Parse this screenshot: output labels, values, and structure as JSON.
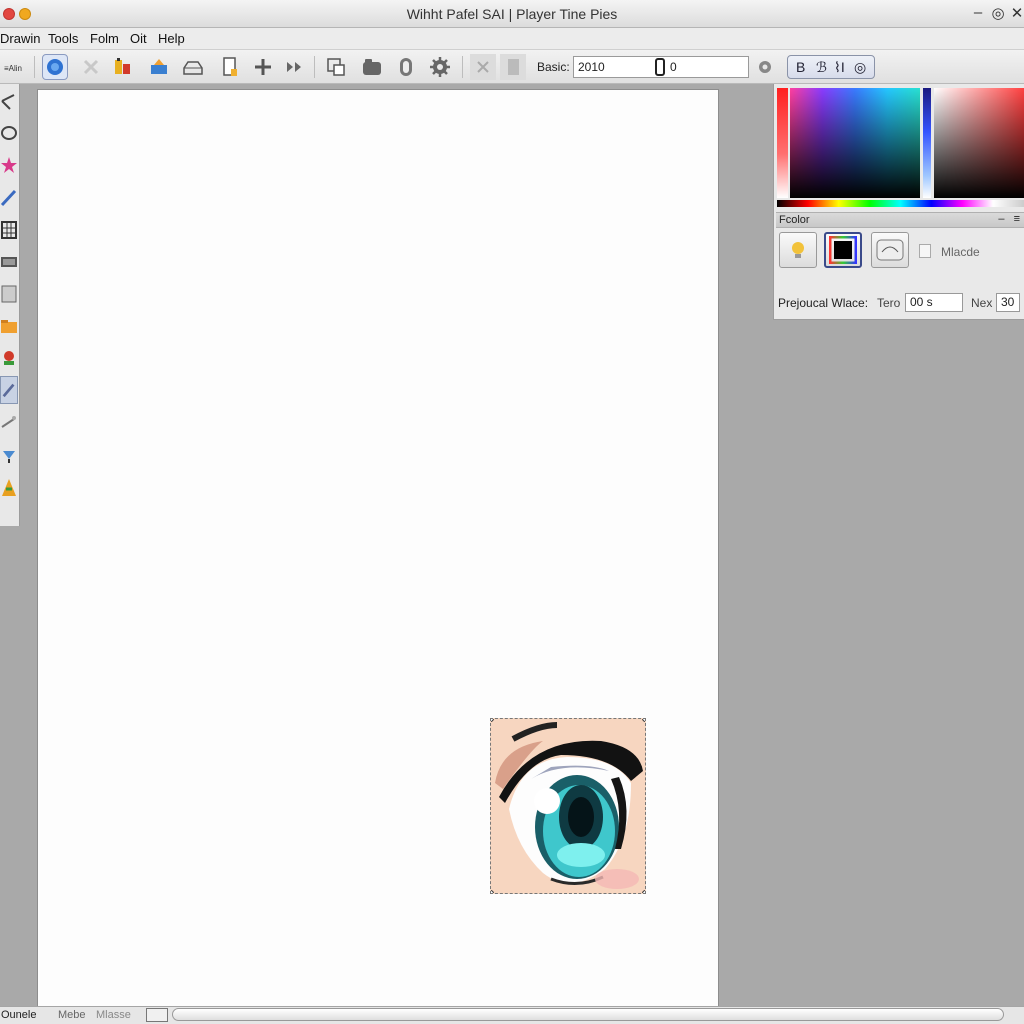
{
  "window": {
    "title": "Wihht Pafel SAI | Player Tine Pies",
    "controls": [
      "–",
      "◎",
      "✕"
    ]
  },
  "menubar": {
    "items": [
      "Drawin",
      "Tools",
      "Folm",
      "Oit",
      "Help"
    ]
  },
  "toolbar": {
    "icons": [
      "brush-settings-icon",
      "close-icon",
      "paint-tube-icon",
      "fill-bucket-icon",
      "tray-icon",
      "document-icon",
      "plus-icon",
      "shuffle-icon",
      "crop-icon",
      "folder-icon",
      "capsule-icon",
      "gear-icon",
      "cancel-icon",
      "page-icon"
    ],
    "basic_label": "Basic:",
    "basic_value": "2010",
    "basic_value2": "0",
    "format_buttons": [
      "B",
      "ℬ",
      "⌇I",
      "◎"
    ]
  },
  "toolbox": {
    "tools": [
      "select-tool-icon",
      "lasso-tool-icon",
      "star-tool-icon",
      "pen-tool-icon",
      "grid-tool-icon",
      "film-tool-icon",
      "layer-tool-icon",
      "folder-tool-icon",
      "flower-tool-icon",
      "brush-tool-icon",
      "wand-tool-icon",
      "dropper-tool-icon",
      "cone-tool-icon"
    ]
  },
  "color_panel": {
    "header": "Fcolor",
    "header_controls": [
      "–",
      "≡"
    ],
    "swatches": [
      "light-bulb-icon",
      "color-frame-icon",
      "meter-icon"
    ],
    "checkbox_label": "Mlacde",
    "prop_label": "Prejoucal Wlace:",
    "prop_label2": "Tero",
    "prop_value": "00 s",
    "prop_label3": "Nex",
    "prop_value2": "30"
  },
  "statusbar": {
    "left_text": "Ounele",
    "mid_text": "Mebe",
    "mid_text2": "Mlasse"
  }
}
